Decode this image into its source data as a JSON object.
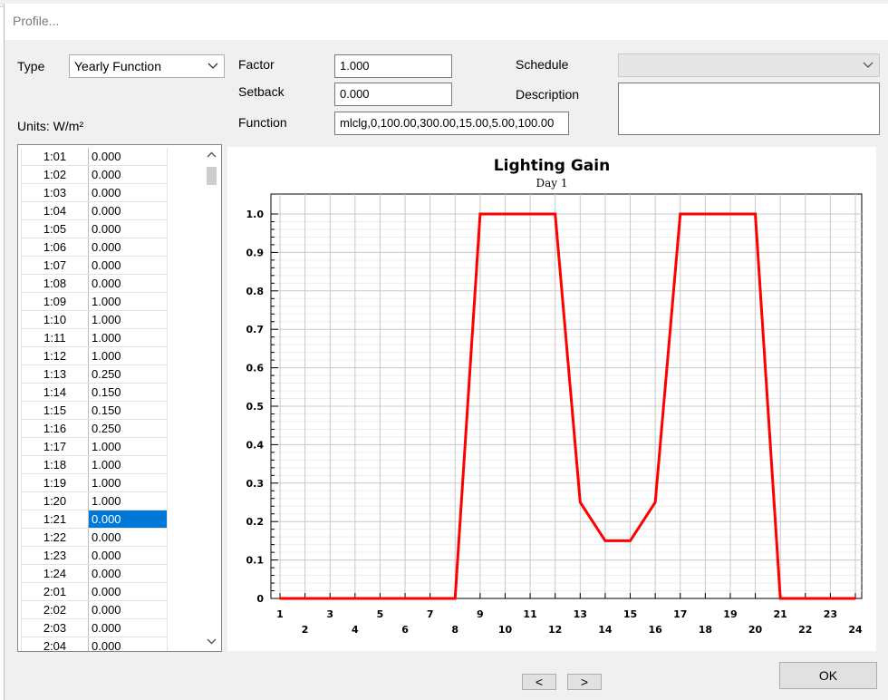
{
  "window": {
    "title": "Profile..."
  },
  "form": {
    "type_label": "Type",
    "type_value": "Yearly Function",
    "units_label": "Units: W/m²",
    "factor_label": "Factor",
    "factor_value": "1.000",
    "setback_label": "Setback",
    "setback_value": "0.000",
    "function_label": "Function",
    "function_value": "mlclg,0,100.00,300.00,15.00,5.00,100.00",
    "schedule_label": "Schedule",
    "schedule_value": "",
    "description_label": "Description",
    "description_value": ""
  },
  "table": {
    "selected_index": 20,
    "rows": [
      {
        "time": "1:01",
        "value": "0.000"
      },
      {
        "time": "1:02",
        "value": "0.000"
      },
      {
        "time": "1:03",
        "value": "0.000"
      },
      {
        "time": "1:04",
        "value": "0.000"
      },
      {
        "time": "1:05",
        "value": "0.000"
      },
      {
        "time": "1:06",
        "value": "0.000"
      },
      {
        "time": "1:07",
        "value": "0.000"
      },
      {
        "time": "1:08",
        "value": "0.000"
      },
      {
        "time": "1:09",
        "value": "1.000"
      },
      {
        "time": "1:10",
        "value": "1.000"
      },
      {
        "time": "1:11",
        "value": "1.000"
      },
      {
        "time": "1:12",
        "value": "1.000"
      },
      {
        "time": "1:13",
        "value": "0.250"
      },
      {
        "time": "1:14",
        "value": "0.150"
      },
      {
        "time": "1:15",
        "value": "0.150"
      },
      {
        "time": "1:16",
        "value": "0.250"
      },
      {
        "time": "1:17",
        "value": "1.000"
      },
      {
        "time": "1:18",
        "value": "1.000"
      },
      {
        "time": "1:19",
        "value": "1.000"
      },
      {
        "time": "1:20",
        "value": "1.000"
      },
      {
        "time": "1:21",
        "value": "0.000"
      },
      {
        "time": "1:22",
        "value": "0.000"
      },
      {
        "time": "1:23",
        "value": "0.000"
      },
      {
        "time": "1:24",
        "value": "0.000"
      },
      {
        "time": "2:01",
        "value": "0.000"
      },
      {
        "time": "2:02",
        "value": "0.000"
      },
      {
        "time": "2:03",
        "value": "0.000"
      },
      {
        "time": "2:04",
        "value": "0.000"
      }
    ]
  },
  "chart_data": {
    "type": "line",
    "title": "Lighting Gain",
    "subtitle": "Day 1",
    "xlabel": "",
    "ylabel": "",
    "xlim": [
      1,
      24
    ],
    "ylim": [
      0,
      1.0
    ],
    "x_ticks_odd": [
      "1",
      "3",
      "5",
      "7",
      "9",
      "11",
      "13",
      "15",
      "17",
      "19",
      "21",
      "23"
    ],
    "x_ticks_even": [
      "2",
      "4",
      "6",
      "8",
      "10",
      "12",
      "14",
      "16",
      "18",
      "20",
      "22",
      "24"
    ],
    "y_ticks": [
      "0",
      "0.1",
      "0.2",
      "0.3",
      "0.4",
      "0.5",
      "0.6",
      "0.7",
      "0.8",
      "0.9",
      "1.0"
    ],
    "grid": true,
    "series": [
      {
        "color": "#ff0000",
        "x": [
          1,
          2,
          3,
          4,
          5,
          6,
          7,
          8,
          9,
          10,
          11,
          12,
          13,
          14,
          15,
          16,
          17,
          18,
          19,
          20,
          21,
          22,
          23,
          24
        ],
        "values": [
          0,
          0,
          0,
          0,
          0,
          0,
          0,
          0,
          1.0,
          1.0,
          1.0,
          1.0,
          0.25,
          0.15,
          0.15,
          0.25,
          1.0,
          1.0,
          1.0,
          1.0,
          0,
          0,
          0,
          0
        ]
      }
    ]
  },
  "buttons": {
    "prev_label": "<",
    "next_label": ">",
    "ok_label": "OK"
  },
  "icons": {
    "dropdown": "chevron-down-icon",
    "scroll_up": "chevron-up-icon",
    "scroll_down": "chevron-down-icon"
  }
}
